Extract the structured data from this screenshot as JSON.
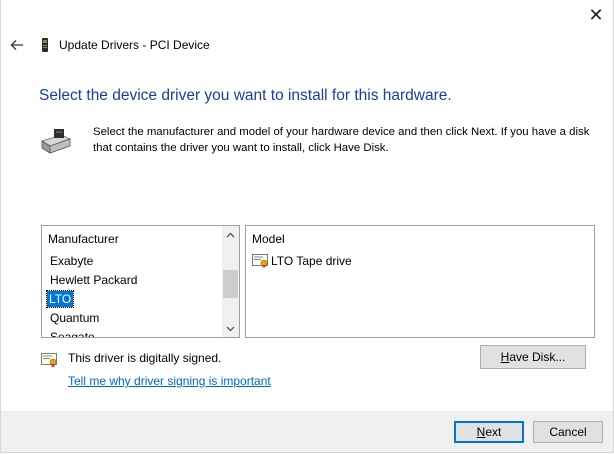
{
  "window": {
    "title": "Update Drivers - PCI Device",
    "close_glyph": "✕"
  },
  "heading": "Select the device driver you want to install for this hardware.",
  "description": "Select the manufacturer and model of your hardware device and then click Next. If you have a disk that contains the driver you want to install, click Have Disk.",
  "manufacturer_list": {
    "header": "Manufacturer",
    "items": [
      "Exabyte",
      "Hewlett Packard",
      "LTO",
      "Quantum",
      "Seagate"
    ],
    "selected": "LTO"
  },
  "model_list": {
    "header": "Model",
    "items": [
      "LTO Tape drive"
    ]
  },
  "signing": {
    "status_text": "This driver is digitally signed.",
    "link_text": "Tell me why driver signing is important"
  },
  "buttons": {
    "have_disk_mnemonic": "H",
    "have_disk_rest": "ave Disk...",
    "next_mnemonic": "N",
    "next_rest": "ext",
    "cancel": "Cancel"
  },
  "colors": {
    "heading": "#1c3d9a",
    "selection": "#0078d7",
    "link": "#0066cc",
    "footer": "#f0f0f0"
  }
}
